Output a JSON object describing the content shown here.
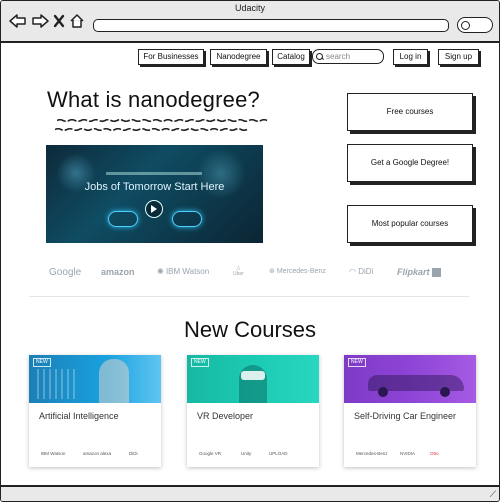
{
  "window": {
    "title": "Udacity"
  },
  "topnav": {
    "for_businesses": "For Businesses",
    "nanodegree": "Nanodegree",
    "catalog": "Catalog",
    "search_placeholder": "search",
    "login": "Log in",
    "signup": "Sign up"
  },
  "hero": {
    "headline": "What is nanodegree?",
    "video_title": "Jobs of Tomorrow Start Here"
  },
  "side_buttons": {
    "free_courses": "Free courses",
    "google_degree": "Get a Google Degree!",
    "popular": "Most popular courses"
  },
  "logos": [
    "Google",
    "amazon",
    "IBM Watson",
    "Uber",
    "Mercedes-Benz",
    "DiDi",
    "Flipkart"
  ],
  "courses_heading": "New Courses",
  "courses": [
    {
      "badge": "NEW",
      "title": "Artificial Intelligence",
      "partners": [
        "IBM Watson",
        "amazon alexa",
        "DiDi"
      ],
      "color": "#1aa2e0"
    },
    {
      "badge": "NEW",
      "title": "VR Developer",
      "partners": [
        "Google VR",
        "Unity",
        "UPLOAD"
      ],
      "color": "#1ccbb3"
    },
    {
      "badge": "NEW",
      "title": "Self-Driving Car Engineer",
      "partners": [
        "Mercedes-Benz",
        "NVIDIA",
        "Otto"
      ],
      "color": "#8e44d6"
    }
  ],
  "colors": {
    "ai_card": "#1aa2e0",
    "vr_card": "#1ccbb3",
    "car_card": "#8e44d6"
  }
}
